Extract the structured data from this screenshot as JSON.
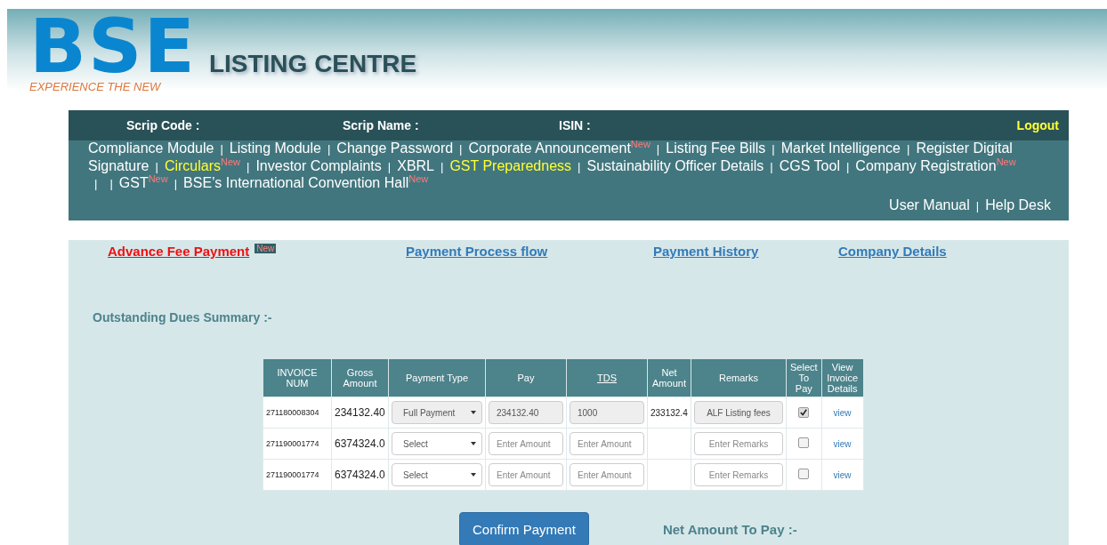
{
  "header": {
    "logo": "BSE",
    "tagline": "EXPERIENCE THE NEW",
    "title": "LISTING CENTRE"
  },
  "infobar": {
    "fields": [
      "Scrip Code :",
      "Scrip Name :",
      "ISIN :"
    ],
    "logout": "Logout"
  },
  "nav": [
    [
      {
        "kind": "link",
        "text": "Compliance Module",
        "highlight": false
      },
      {
        "kind": "sep",
        "text": "|"
      },
      {
        "kind": "link",
        "text": "Listing Module",
        "highlight": false
      },
      {
        "kind": "sep",
        "text": "|"
      },
      {
        "kind": "link",
        "text": "Change Password",
        "highlight": false
      },
      {
        "kind": "sep",
        "text": "|"
      },
      {
        "kind": "link",
        "text": "Corporate Announcement",
        "highlight": false,
        "badge": "New"
      },
      {
        "kind": "sep",
        "text": "|"
      },
      {
        "kind": "link",
        "text": "Listing Fee Bills",
        "highlight": false
      },
      {
        "kind": "sep",
        "text": "|"
      },
      {
        "kind": "link",
        "text": "Market Intelligence",
        "highlight": false
      },
      {
        "kind": "sep",
        "text": "|"
      },
      {
        "kind": "link",
        "text": "Register Digital",
        "highlight": false
      }
    ],
    [
      {
        "kind": "link",
        "text": "Signature",
        "highlight": false
      },
      {
        "kind": "sep",
        "text": "|"
      },
      {
        "kind": "link",
        "text": "Circulars",
        "highlight": true,
        "badge": "New"
      },
      {
        "kind": "sep",
        "text": "|"
      },
      {
        "kind": "link",
        "text": "Investor Complaints",
        "highlight": false
      },
      {
        "kind": "sep",
        "text": "|"
      },
      {
        "kind": "link",
        "text": "XBRL",
        "highlight": false
      },
      {
        "kind": "sep",
        "text": "|"
      },
      {
        "kind": "link",
        "text": "GST Preparedness",
        "highlight": true
      },
      {
        "kind": "sep",
        "text": "|"
      },
      {
        "kind": "link",
        "text": "Sustainability Officer Details",
        "highlight": false
      },
      {
        "kind": "sep",
        "text": "|"
      },
      {
        "kind": "link",
        "text": "CGS Tool",
        "highlight": false
      },
      {
        "kind": "sep",
        "text": "|"
      },
      {
        "kind": "link",
        "text": "Company Registration",
        "highlight": false,
        "badge": "New"
      }
    ],
    [
      {
        "kind": "sep",
        "text": "|"
      },
      {
        "kind": "sep",
        "text": "|"
      },
      {
        "kind": "link",
        "text": "GST",
        "highlight": false,
        "badge": "New"
      },
      {
        "kind": "sep",
        "text": "|"
      },
      {
        "kind": "link",
        "text": "BSE’s International Convention Hall",
        "highlight": false,
        "badge": "New"
      }
    ]
  ],
  "help_links": [
    {
      "kind": "link",
      "text": "User Manual"
    },
    {
      "kind": "sep",
      "text": "|"
    },
    {
      "kind": "link",
      "text": "Help Desk"
    }
  ],
  "tabs": [
    {
      "label": "Advance Fee Payment",
      "selected": true,
      "badge": "New"
    },
    {
      "label": "Payment Process flow",
      "selected": false
    },
    {
      "label": "Payment History",
      "selected": false
    },
    {
      "label": "Company Details",
      "selected": false
    }
  ],
  "section_title": "Outstanding Dues Summary :-",
  "table": {
    "columns": [
      {
        "label": "INVOICE NUM",
        "link": false
      },
      {
        "label": "Gross Amount",
        "link": false
      },
      {
        "label": "Payment Type",
        "link": false
      },
      {
        "label": "Pay",
        "link": false
      },
      {
        "label": "TDS",
        "link": true
      },
      {
        "label": "Net Amount",
        "link": false
      },
      {
        "label": "Remarks",
        "link": false
      },
      {
        "label": "Select To Pay",
        "link": false
      },
      {
        "label": "View Invoice Details",
        "link": false
      }
    ],
    "rows": [
      {
        "invoice": "271180008304",
        "gross": "234132.40",
        "payment_type": {
          "value": "Full Payment",
          "disabled": true
        },
        "pay": {
          "value": "234132.40",
          "disabled": true
        },
        "tds": {
          "value": "1000",
          "disabled": true
        },
        "net": "233132.4",
        "remarks": {
          "value": "ALF Listing fees",
          "disabled": true
        },
        "checked": true,
        "view": "view"
      },
      {
        "invoice": "271190001774",
        "gross": "6374324.0",
        "payment_type": {
          "value": "Select",
          "disabled": false
        },
        "pay": {
          "placeholder": "Enter Amount",
          "disabled": false
        },
        "tds": {
          "placeholder": "Enter Amount",
          "disabled": false
        },
        "remarks": {
          "placeholder": "Enter Remarks",
          "disabled": false
        },
        "checked": false,
        "view": "view"
      },
      {
        "invoice": "271190001774",
        "gross": "6374324.0",
        "payment_type": {
          "value": "Select",
          "disabled": false
        },
        "pay": {
          "placeholder": "Enter Amount",
          "disabled": false
        },
        "tds": {
          "placeholder": "Enter Amount",
          "disabled": false
        },
        "remarks": {
          "placeholder": "Enter Remarks",
          "disabled": false
        },
        "checked": false,
        "view": "view"
      }
    ]
  },
  "confirm_button": "Confirm Payment",
  "net_total_label": "Net Amount To Pay :-"
}
